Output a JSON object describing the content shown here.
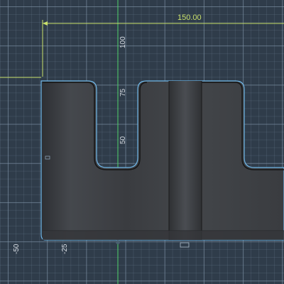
{
  "viewport": {
    "name": "3D sketch viewport",
    "colors": {
      "background": "#2f3c4a",
      "grid_major": "#8296aa",
      "model_body": "#3b3d41",
      "model_edge": "#111111",
      "selection_outline": "#6fb7e8",
      "dimension": "#c9e06b",
      "axis_green": "#4fd36a"
    }
  },
  "dimension": {
    "value": "150.00"
  },
  "axis_labels": {
    "horizontal": [
      "-50",
      "-25"
    ],
    "vertical": [
      "100",
      "75",
      "50"
    ]
  }
}
